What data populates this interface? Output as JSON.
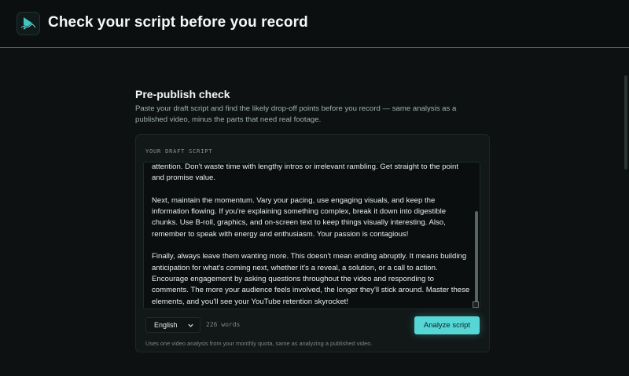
{
  "header": {
    "title": "Check your script before you record",
    "logo_icon": "play-wave-logo"
  },
  "section": {
    "title": "Pre-publish check",
    "description": "Paste your draft script and find the likely drop-off points before you record — same analysis as a published video, minus the parts that need real footage."
  },
  "form": {
    "label": "YOUR DRAFT SCRIPT",
    "script_paragraphs": [
      "attention. Don't waste time with lengthy intros or irrelevant rambling. Get straight to the point and promise value.",
      "Next, maintain the momentum. Vary your pacing, use engaging visuals, and keep the information flowing. If you're explaining something complex, break it down into digestible chunks. Use B-roll, graphics, and on-screen text to keep things visually interesting. Also, remember to speak with energy and enthusiasm. Your passion is contagious!",
      "Finally, always leave them wanting more. This doesn't mean ending abruptly. It means building anticipation for what's coming next, whether it's a reveal, a solution, or a call to action. Encourage engagement by asking questions throughout the video and responding to comments. The more your audience feels involved, the longer they'll stick around. Master these elements, and you'll see your YouTube retention skyrocket!"
    ],
    "language": "English",
    "word_count": "226 words",
    "analyze_label": "Analyze script",
    "quota_note": "Uses one video analysis from your monthly quota, same as analyzing a published video."
  },
  "colors": {
    "accent": "#56d6d4",
    "background": "#0d1111",
    "header_border": "#2f6a6a"
  }
}
